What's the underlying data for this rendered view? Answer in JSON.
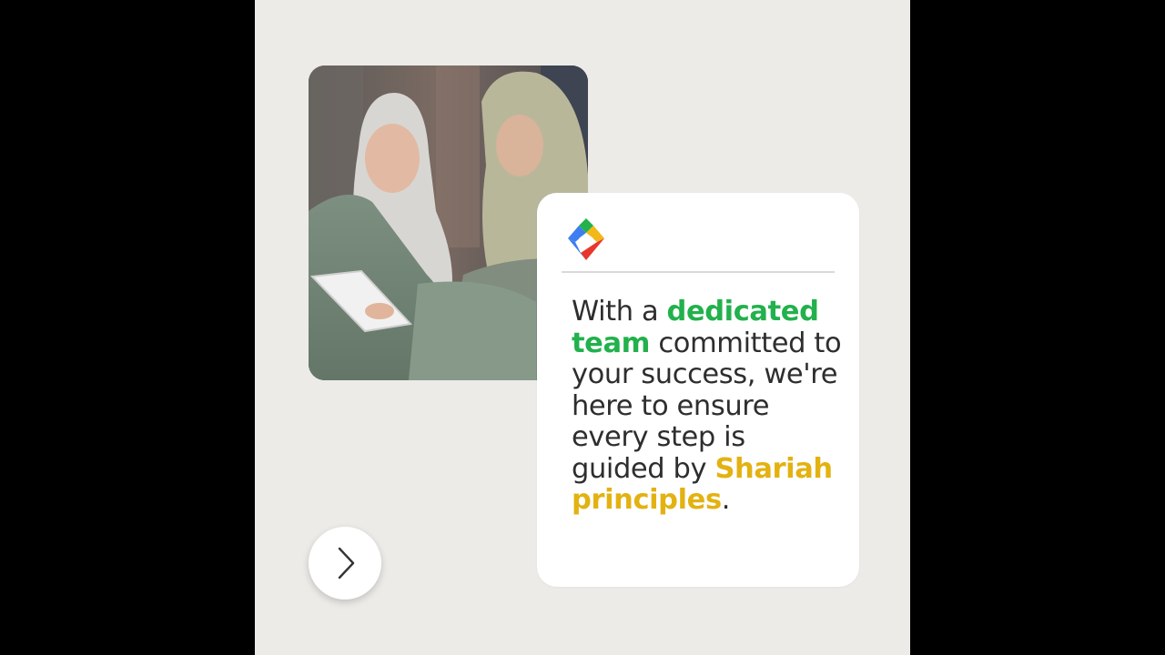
{
  "video": {
    "photo_description_icon": "photo-of-two-women-with-tablet"
  },
  "card": {
    "logo_icon": "diamond-logo-icon",
    "message": {
      "part1": "With a ",
      "highlight1": "dedicated team",
      "part2": " committed to your success, we're here to ensure every step is guided by ",
      "highlight2": "Shariah principles",
      "part3": "."
    }
  },
  "navigation": {
    "next_icon": "chevron-right-icon"
  },
  "colors": {
    "background": "#ECEBE8",
    "letterbox": "#000000",
    "card": "#FFFFFF",
    "text": "#2E2E2E",
    "highlight_green": "#22B14C",
    "highlight_gold": "#E3B212",
    "logo_blue": "#3D7EF0",
    "logo_green": "#22B14C",
    "logo_yellow": "#F2B81A",
    "logo_red": "#E8372C"
  }
}
